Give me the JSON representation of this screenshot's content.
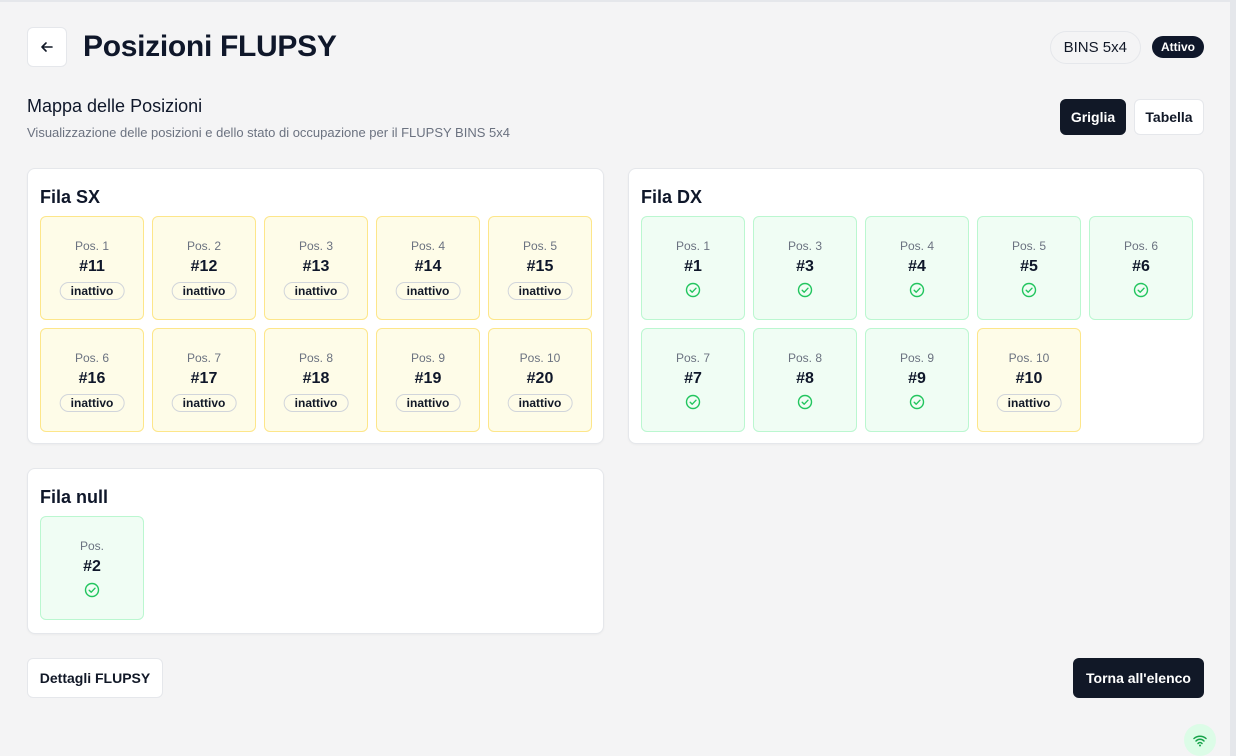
{
  "header": {
    "title": "Posizioni FLUPSY",
    "flupsy_name": "BINS 5x4",
    "status": "Attivo"
  },
  "section": {
    "title": "Mappa delle Posizioni",
    "subtitle": "Visualizzazione delle posizioni e dello stato di occupazione per il FLUPSY BINS 5x4"
  },
  "view_toggle": {
    "grid_label": "Griglia",
    "table_label": "Tabella",
    "selected": "Griglia"
  },
  "rows": [
    {
      "title": "Fila SX",
      "positions": [
        {
          "label": "Pos. 1",
          "number": "#11",
          "status": "inattivo"
        },
        {
          "label": "Pos. 2",
          "number": "#12",
          "status": "inattivo"
        },
        {
          "label": "Pos. 3",
          "number": "#13",
          "status": "inattivo"
        },
        {
          "label": "Pos. 4",
          "number": "#14",
          "status": "inattivo"
        },
        {
          "label": "Pos. 5",
          "number": "#15",
          "status": "inattivo"
        },
        {
          "label": "Pos. 6",
          "number": "#16",
          "status": "inattivo"
        },
        {
          "label": "Pos. 7",
          "number": "#17",
          "status": "inattivo"
        },
        {
          "label": "Pos. 8",
          "number": "#18",
          "status": "inattivo"
        },
        {
          "label": "Pos. 9",
          "number": "#19",
          "status": "inattivo"
        },
        {
          "label": "Pos. 10",
          "number": "#20",
          "status": "inattivo"
        }
      ]
    },
    {
      "title": "Fila DX",
      "positions": [
        {
          "label": "Pos. 1",
          "number": "#1",
          "status": "active"
        },
        {
          "label": "Pos. 3",
          "number": "#3",
          "status": "active"
        },
        {
          "label": "Pos. 4",
          "number": "#4",
          "status": "active"
        },
        {
          "label": "Pos. 5",
          "number": "#5",
          "status": "active"
        },
        {
          "label": "Pos. 6",
          "number": "#6",
          "status": "active"
        },
        {
          "label": "Pos. 7",
          "number": "#7",
          "status": "active"
        },
        {
          "label": "Pos. 8",
          "number": "#8",
          "status": "active"
        },
        {
          "label": "Pos. 9",
          "number": "#9",
          "status": "active"
        },
        {
          "label": "Pos. 10",
          "number": "#10",
          "status": "inattivo"
        }
      ]
    },
    {
      "title": "Fila null",
      "positions": [
        {
          "label": "Pos.",
          "number": "#2",
          "status": "active"
        }
      ]
    }
  ],
  "footer": {
    "details_label": "Dettagli FLUPSY",
    "back_label": "Torna all'elenco"
  },
  "colors": {
    "inactive_bg": "#fefce8",
    "inactive_border": "#fde68a",
    "active_bg": "#f0fdf4",
    "active_border": "#bbf7d0",
    "check_green": "#22c55e",
    "primary_dark": "#111827"
  },
  "icons": {
    "back": "arrow-left-icon",
    "occupied": "circle-check-icon",
    "connection": "wifi-icon"
  }
}
